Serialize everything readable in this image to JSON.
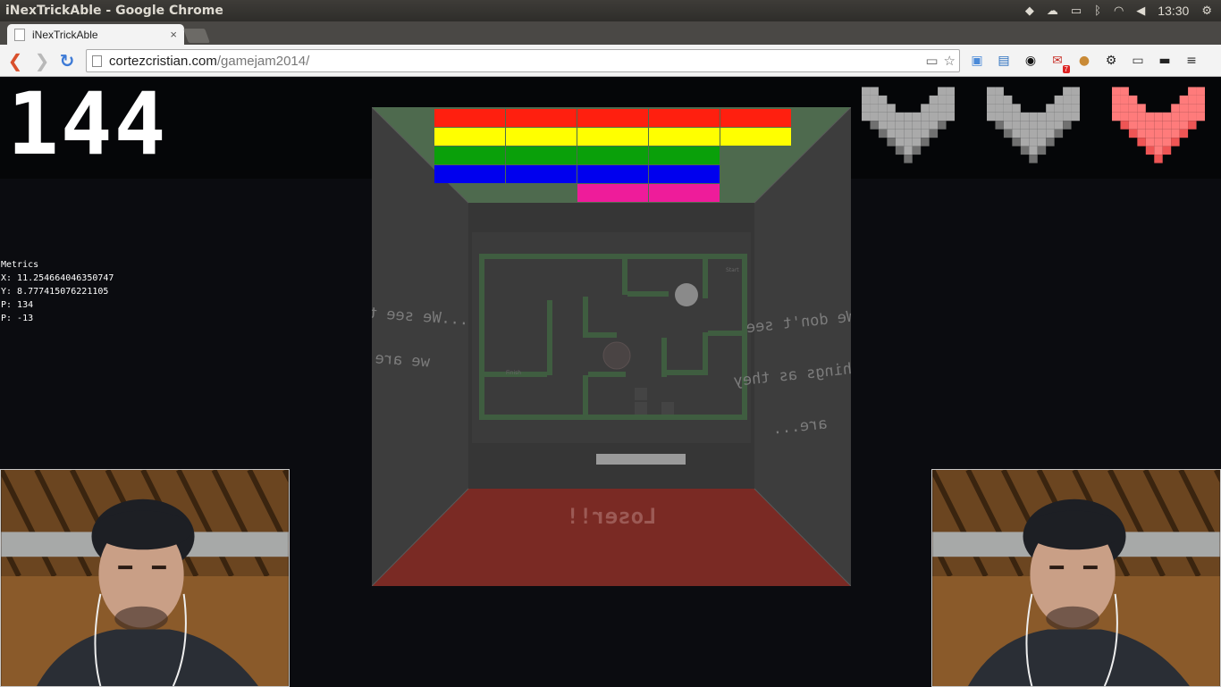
{
  "os": {
    "window_title": "iNexTrickAble - Google Chrome",
    "clock": "13:30",
    "tray_icons": [
      "dropbox-icon",
      "cloud-icon",
      "battery-icon",
      "bluetooth-icon",
      "wifi-icon",
      "volume-icon",
      "settings-cog-icon"
    ]
  },
  "browser": {
    "tab": {
      "label": "iNexTrickAble",
      "close": "×"
    },
    "url_host": "cortezcristian.com",
    "url_path": "/gamejam2014/",
    "nav": {
      "back": "❮",
      "forward": "❯",
      "reload": "↻"
    },
    "extensions": [
      {
        "name": "folder-ext-icon",
        "glyph": "▣",
        "color": "#4a8ad8"
      },
      {
        "name": "screenshot-ext-icon",
        "glyph": "▤",
        "color": "#2a6fbf"
      },
      {
        "name": "eye-ext-icon",
        "glyph": "◉",
        "color": "#111111"
      },
      {
        "name": "gmail-ext-icon",
        "glyph": "✉",
        "color": "#c8312a",
        "badge": "7"
      },
      {
        "name": "cookie-ext-icon",
        "glyph": "●",
        "color": "#c98a36"
      },
      {
        "name": "gear-ext-icon",
        "glyph": "⚙",
        "color": "#222222"
      },
      {
        "name": "cast-ext-icon",
        "glyph": "▭",
        "color": "#333333"
      },
      {
        "name": "incognito-ext-icon",
        "glyph": "▬",
        "color": "#222222"
      },
      {
        "name": "menu-icon",
        "glyph": "≡",
        "color": "#333333"
      }
    ]
  },
  "game": {
    "score": "144",
    "metrics": {
      "heading": "Metrics",
      "x": "X: 11.254664046350747",
      "y": "Y: 8.777415076221105",
      "p1": "P: 134",
      "p2": "P: -13"
    },
    "lives": [
      {
        "state": "lost",
        "color": "#aaaaaa",
        "dark": "#707070"
      },
      {
        "state": "lost",
        "color": "#aaaaaa",
        "dark": "#707070"
      },
      {
        "state": "alive",
        "color": "#ff7b7b",
        "dark": "#ee5555"
      }
    ],
    "bricks": [
      {
        "color": "#ff1f0f",
        "count": 5
      },
      {
        "color": "#ffff00",
        "count": 5
      },
      {
        "color": "#0aa00a",
        "count": 4
      },
      {
        "color": "#0000ee",
        "count": 4
      },
      {
        "color": "#ee1c9a",
        "count": 2,
        "offset": 2
      }
    ],
    "wall_left_text": [
      "...We see them as",
      "we are."
    ],
    "wall_right_text": [
      "We don't see",
      "things as they",
      "are..."
    ],
    "floor_text": "Loser!!",
    "maze_labels": {
      "start": "Start",
      "finish": "Finish"
    },
    "colors": {
      "ceiling": "#4e6a4e",
      "wall": "#3d3d3d",
      "floor": "#7a2a24",
      "maze_wall": "#3f5d40"
    }
  }
}
